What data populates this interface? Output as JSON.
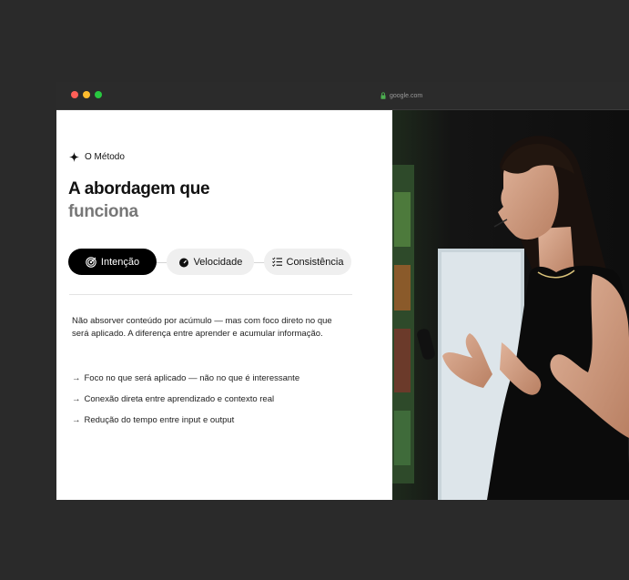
{
  "browser": {
    "url": "google.com"
  },
  "section": {
    "eyebrow": "O Método",
    "title_line1": "A abordagem que",
    "title_line2": "funciona"
  },
  "tabs": [
    {
      "label": "Intenção",
      "icon": "target-icon",
      "active": true
    },
    {
      "label": "Velocidade",
      "icon": "speedometer-icon",
      "active": false
    },
    {
      "label": "Consistência",
      "icon": "checklist-icon",
      "active": false
    }
  ],
  "content": {
    "description": "Não absorver conteúdo por acúmulo — mas com foco direto no que será aplicado. A diferença entre aprender e acumular informação.",
    "bullets": [
      "Foco no que será aplicado — não no que é interessante",
      "Conexão direta entre aprendizado e contexto real",
      "Redução do tempo entre input e output"
    ],
    "arrow": "→"
  },
  "colors": {
    "active_tab": "#000000",
    "inactive_tab": "#efefef",
    "title_muted": "#777777"
  }
}
